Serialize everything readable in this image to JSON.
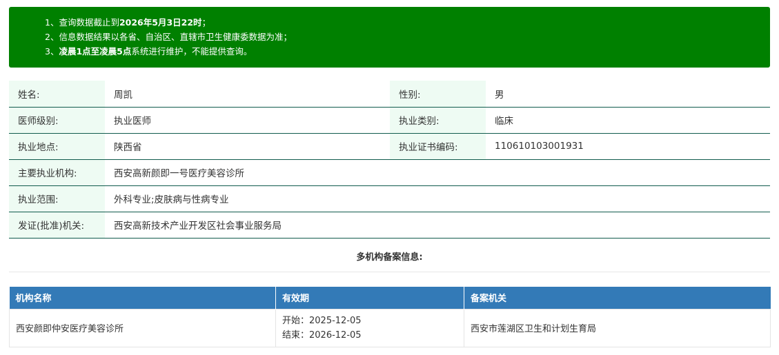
{
  "notice": {
    "line1_prefix": "1、查询数据截止到",
    "line1_bold": "2026年5月3日22时",
    "line1_suffix": "；",
    "line2": "2、信息数据结果以各省、自治区、直辖市卫生健康委数据为准；",
    "line3_prefix": "3、",
    "line3_bold": "凌晨1点至凌晨5点",
    "line3_suffix": "系统进行维护，不能提供查询。",
    "color": "#008000"
  },
  "doctor": {
    "name_label": "姓名:",
    "name": "周凯",
    "gender_label": "性别:",
    "gender": "男",
    "level_label": "医师级别:",
    "level": "执业医师",
    "category_label": "执业类别:",
    "category": "临床",
    "location_label": "执业地点:",
    "location": "陕西省",
    "cert_label": "执业证书编码:",
    "cert": "110610103001931",
    "institution_label": "主要执业机构:",
    "institution": "西安高新颜即一号医疗美容诊所",
    "scope_label": "执业范围:",
    "scope": "外科专业;皮肤病与性病专业",
    "authority_label": "发证(批准)机关:",
    "authority": "西安高新技术产业开发区社会事业服务局"
  },
  "multi_title": "多机构备案信息:",
  "records": {
    "headers": [
      "机构名称",
      "有效期",
      "备案机关"
    ],
    "header_color": "#337ab7",
    "rows": [
      {
        "org": "西安颜即仲安医疗美容诊所",
        "start": "开始：2025-12-05",
        "end": "结束：2026-12-05",
        "authority": "西安市莲湖区卫生和计划生育局"
      }
    ]
  }
}
